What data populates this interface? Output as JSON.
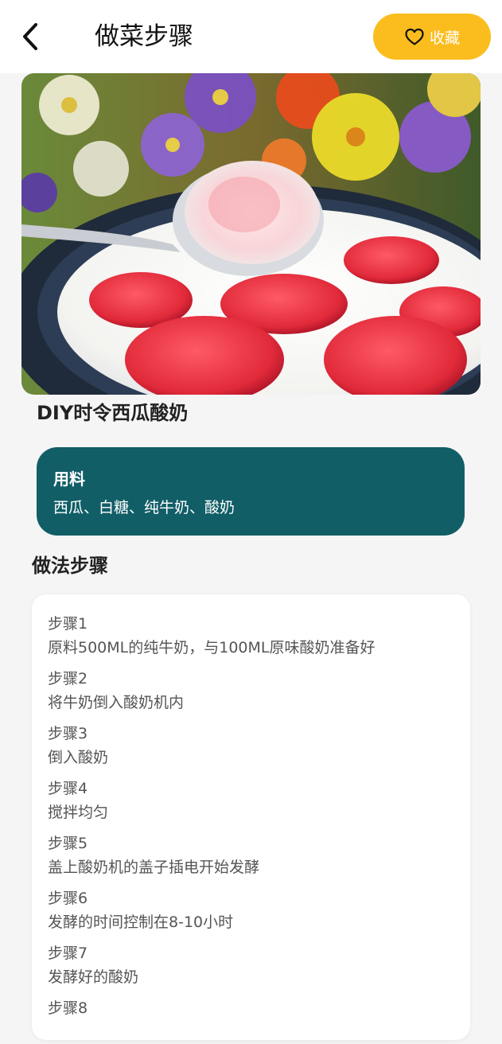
{
  "header": {
    "title": "做菜步骤",
    "favorite_label": "收藏"
  },
  "colors": {
    "accent_yellow": "#fbbd1e",
    "ingredients_bg": "#115e67"
  },
  "hero": {
    "image_icon": "yogurt-with-watermelon-photo"
  },
  "recipe": {
    "name": "DIY时令西瓜酸奶",
    "ingredients_title": "用料",
    "ingredients": "西瓜、白糖、纯牛奶、酸奶",
    "steps_heading": "做法步骤",
    "steps": [
      {
        "label": "步骤1",
        "text": "原料500ML的纯牛奶，与100ML原味酸奶准备好"
      },
      {
        "label": "步骤2",
        "text": "将牛奶倒入酸奶机内"
      },
      {
        "label": "步骤3",
        "text": "倒入酸奶"
      },
      {
        "label": "步骤4",
        "text": "搅拌均匀"
      },
      {
        "label": "步骤5",
        "text": "盖上酸奶机的盖子插电开始发酵"
      },
      {
        "label": "步骤6",
        "text": "发酵的时间控制在8-10小时"
      },
      {
        "label": "步骤7",
        "text": "发酵好的酸奶"
      },
      {
        "label": "步骤8",
        "text": ""
      }
    ]
  }
}
